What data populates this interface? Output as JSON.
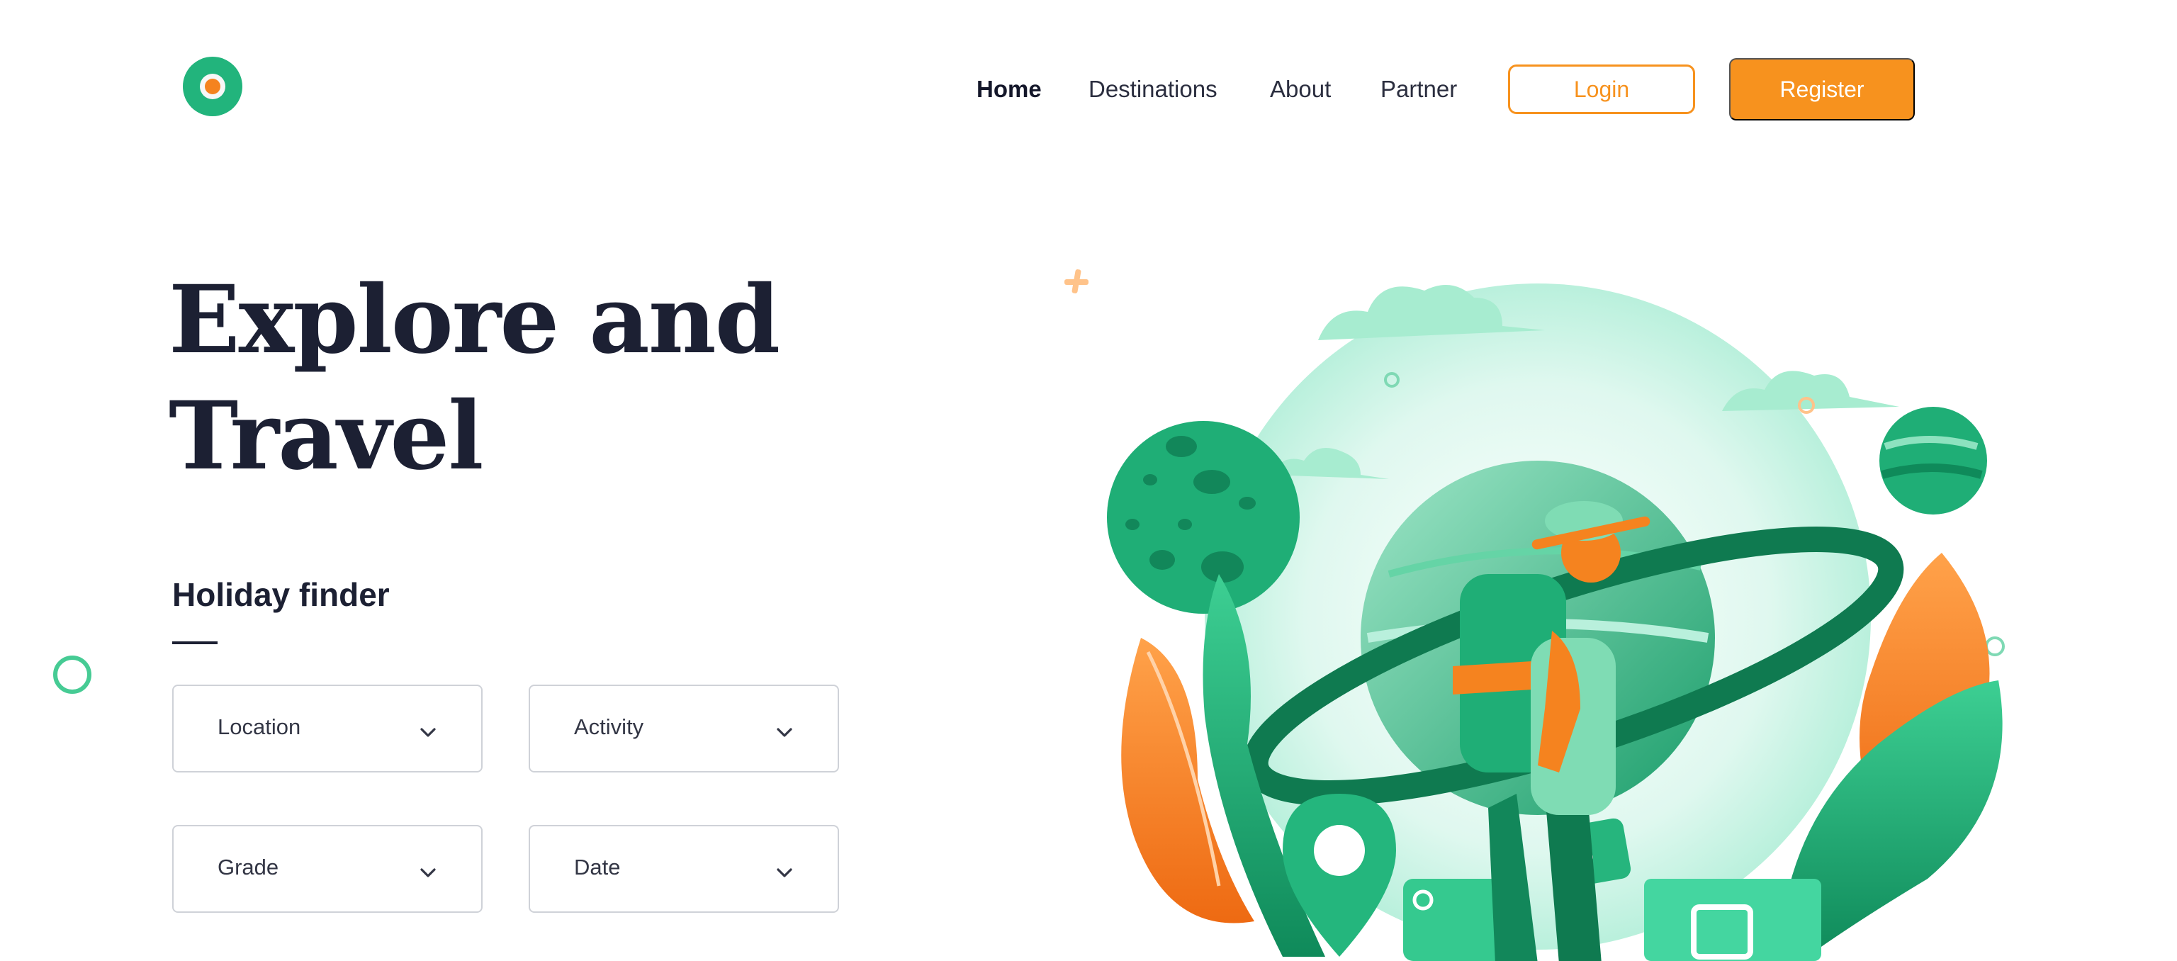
{
  "header": {
    "nav": [
      {
        "label": "Home",
        "active": true
      },
      {
        "label": "Destinations"
      },
      {
        "label": "About"
      },
      {
        "label": "Partner"
      }
    ],
    "login_label": "Login",
    "register_label": "Register"
  },
  "hero": {
    "title_line1": "Explore and",
    "title_line2": "Travel"
  },
  "finder": {
    "heading": "Holiday finder",
    "fields": [
      {
        "label": "Location"
      },
      {
        "label": "Activity"
      },
      {
        "label": "Grade"
      },
      {
        "label": "Date"
      }
    ]
  },
  "colors": {
    "accent": "#f7921e",
    "brand_green": "#22b47c",
    "text_dark": "#1c2033"
  },
  "icons": [
    "logo-icon",
    "chevron-down-icon",
    "traveler-illustration"
  ]
}
